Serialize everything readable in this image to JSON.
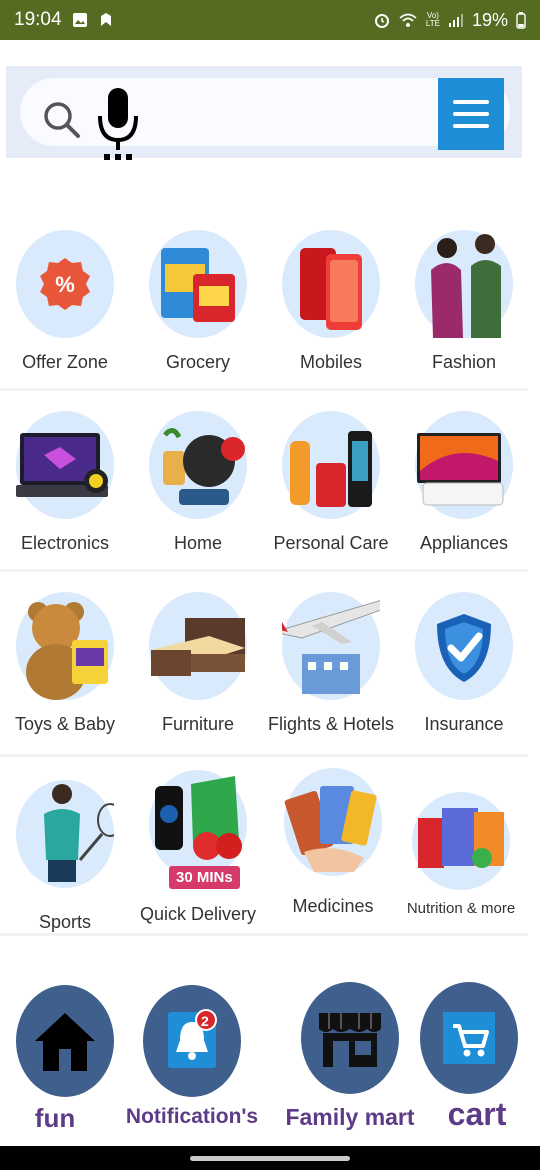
{
  "status": {
    "time": "19:04",
    "volte": "Vo)\nLTE",
    "battery": "19%"
  },
  "search": {
    "placeholder": ""
  },
  "categories": [
    {
      "label": "Offer Zone",
      "icon": "percent-badge-icon"
    },
    {
      "label": "Grocery",
      "icon": "grocery-icon"
    },
    {
      "label": "Mobiles",
      "icon": "phones-icon"
    },
    {
      "label": "Fashion",
      "icon": "fashion-models-icon"
    },
    {
      "label": "Electronics",
      "icon": "laptop-icon"
    },
    {
      "label": "Home",
      "icon": "home-goods-icon"
    },
    {
      "label": "Personal Care",
      "icon": "personal-care-icon"
    },
    {
      "label": "Appliances",
      "icon": "tv-ac-icon"
    },
    {
      "label": "Toys & Baby",
      "icon": "teddy-bear-icon"
    },
    {
      "label": "Furniture",
      "icon": "bed-icon"
    },
    {
      "label": "Flights & Hotels",
      "icon": "airplane-icon"
    },
    {
      "label": "Insurance",
      "icon": "shield-check-icon"
    },
    {
      "label": "Sports",
      "icon": "badminton-player-icon"
    },
    {
      "label": "Quick Delivery",
      "icon": "snacks-icon",
      "badge": "30 MINs"
    },
    {
      "label": "Medicines",
      "icon": "pills-icon"
    },
    {
      "label": "Nutrition & more",
      "icon": "nutrition-icon"
    }
  ],
  "bottom_nav": [
    {
      "label": "fun",
      "icon": "house-icon"
    },
    {
      "label": "Notification's",
      "icon": "bell-icon",
      "count": "2"
    },
    {
      "label": "Family mart",
      "icon": "shop-icon"
    },
    {
      "label": "cart",
      "icon": "cart-icon"
    }
  ],
  "colors": {
    "status_bar": "#556b21",
    "accent_blue": "#1e8fd6",
    "bottom_circle": "#3f5f8c",
    "bottom_label": "#5e3b86",
    "category_circle": "#d9eafc"
  }
}
